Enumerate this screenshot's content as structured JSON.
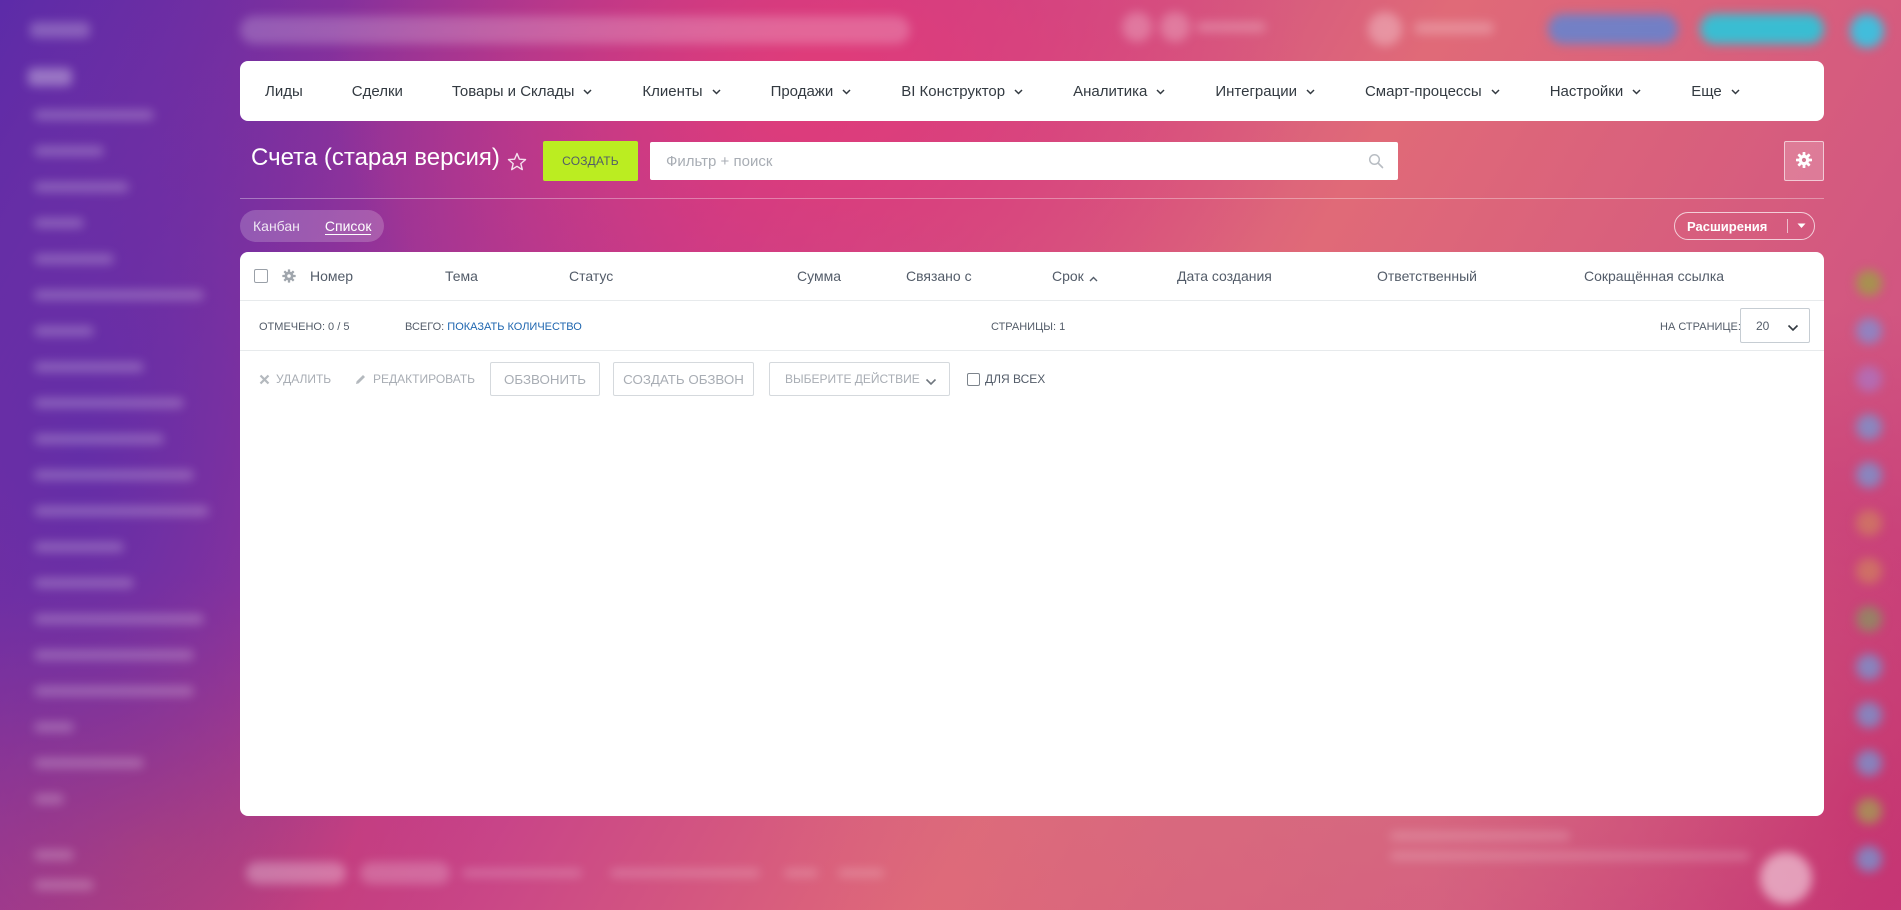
{
  "colors": {
    "create_button": "#bbed21",
    "link": "#2067b0",
    "text": "#535c69"
  },
  "topnav": {
    "items": [
      {
        "label": "Лиды",
        "dropdown": false
      },
      {
        "label": "Сделки",
        "dropdown": false
      },
      {
        "label": "Товары и Склады",
        "dropdown": true
      },
      {
        "label": "Клиенты",
        "dropdown": true
      },
      {
        "label": "Продажи",
        "dropdown": true
      },
      {
        "label": "BI Конструктор",
        "dropdown": true
      },
      {
        "label": "Аналитика",
        "dropdown": true
      },
      {
        "label": "Интеграции",
        "dropdown": true
      },
      {
        "label": "Смарт-процессы",
        "dropdown": true
      },
      {
        "label": "Настройки",
        "dropdown": true
      },
      {
        "label": "Еще",
        "dropdown": true
      }
    ]
  },
  "toolbar": {
    "title": "Счета (старая версия)",
    "create_label": "СОЗДАТЬ",
    "search_placeholder": "Фильтр + поиск",
    "star_icon": "star-icon",
    "settings_icon": "gear-icon"
  },
  "views": {
    "kanban": "Канбан",
    "list": "Список",
    "active": "list"
  },
  "extensions": {
    "label": "Расширения"
  },
  "grid": {
    "columns": [
      "Номер",
      "Тема",
      "Статус",
      "Сумма",
      "Связано с",
      "Срок",
      "Дата создания",
      "Ответственный",
      "Сокращённая ссылка"
    ],
    "sorted_column": "Срок",
    "sort_direction": "asc",
    "info": {
      "selected": "ОТМЕЧЕНО: 0 / 5",
      "total_label": "ВСЕГО:",
      "total_link": "ПОКАЗАТЬ КОЛИЧЕСТВО",
      "pages": "СТРАНИЦЫ: 1",
      "per_page_label": "НА СТРАНИЦЕ:",
      "per_page_value": "20"
    },
    "actions": {
      "delete": "УДАЛИТЬ",
      "edit": "РЕДАКТИРОВАТЬ",
      "call": "ОБЗВОНИТЬ",
      "create_call": "СОЗДАТЬ ОБЗВОН",
      "select_action": "ВЫБЕРИТЕ ДЕЙСТВИЕ",
      "for_all": "ДЛЯ ВСЕХ"
    }
  }
}
